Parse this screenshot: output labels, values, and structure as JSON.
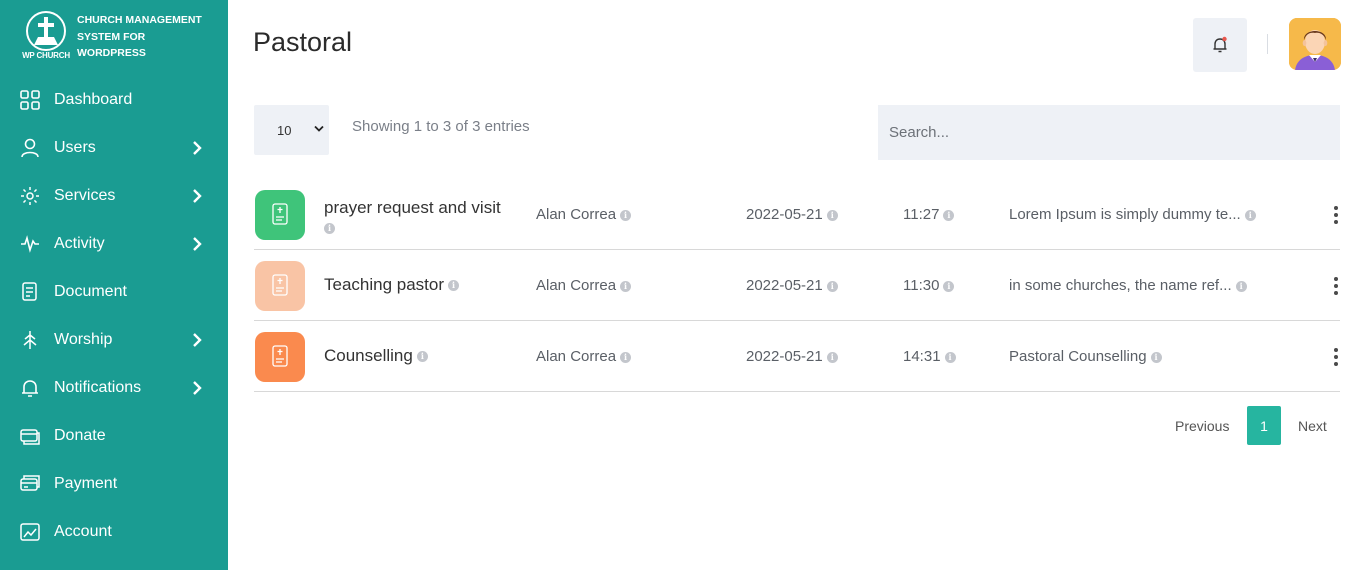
{
  "brand": {
    "logo_text": "WP CHURCH",
    "line1": "CHURCH MANAGEMENT",
    "line2": "SYSTEM FOR",
    "line3": "WORDPRESS"
  },
  "sidebar": {
    "items": [
      {
        "label": "Dashboard",
        "icon": "dashboard-icon",
        "has_submenu": false
      },
      {
        "label": "Users",
        "icon": "user-icon",
        "has_submenu": true
      },
      {
        "label": "Services",
        "icon": "services-icon",
        "has_submenu": true
      },
      {
        "label": "Activity",
        "icon": "activity-icon",
        "has_submenu": true
      },
      {
        "label": "Document",
        "icon": "document-icon",
        "has_submenu": false
      },
      {
        "label": "Worship",
        "icon": "worship-icon",
        "has_submenu": true
      },
      {
        "label": "Notifications",
        "icon": "bell-icon",
        "has_submenu": true
      },
      {
        "label": "Donate",
        "icon": "donate-icon",
        "has_submenu": false
      },
      {
        "label": "Payment",
        "icon": "payment-icon",
        "has_submenu": false
      },
      {
        "label": "Account",
        "icon": "account-icon",
        "has_submenu": false
      }
    ]
  },
  "header": {
    "title": "Pastoral"
  },
  "controls": {
    "page_length": "10",
    "entries_info": "Showing 1 to 3 of 3 entries",
    "search_placeholder": "Search..."
  },
  "table": {
    "rows": [
      {
        "title": "prayer request and visit",
        "person": "Alan Correa",
        "date": "2022-05-21",
        "time": "11:27",
        "description": "Lorem Ipsum is simply dummy te...",
        "icon_color": "#3fc47a"
      },
      {
        "title": "Teaching pastor",
        "person": "Alan Correa",
        "date": "2022-05-21",
        "time": "11:30",
        "description": "in some churches, the name ref...",
        "icon_color": "#f9c4a5"
      },
      {
        "title": "Counselling",
        "person": "Alan Correa",
        "date": "2022-05-21",
        "time": "14:31",
        "description": "Pastoral Counselling",
        "icon_color": "#fa8a4e"
      }
    ]
  },
  "pagination": {
    "previous": "Previous",
    "current": "1",
    "next": "Next"
  },
  "colors": {
    "sidebar": "#1a9c92",
    "accent": "#26b5a0"
  }
}
